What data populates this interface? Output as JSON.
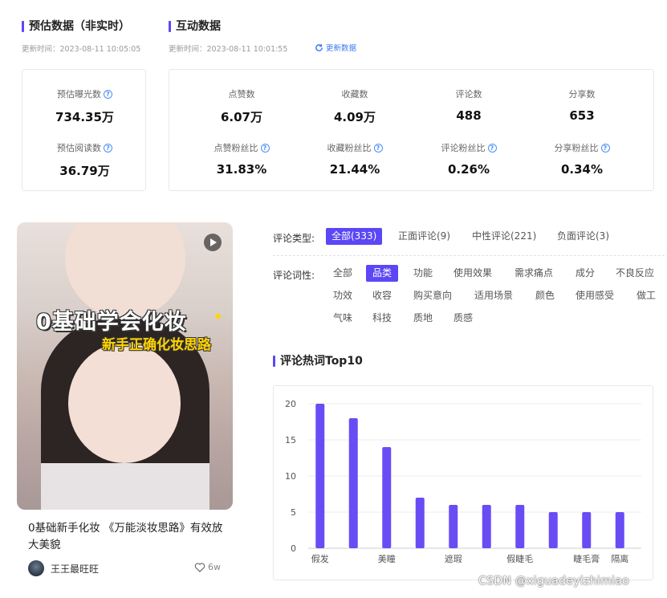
{
  "estimate": {
    "title": "预估数据（非实时）",
    "updated": "更新时间：2023-08-11 10:05:05",
    "metrics": [
      {
        "label": "预估曝光数",
        "value": "734.35万"
      },
      {
        "label": "预估阅读数",
        "value": "36.79万"
      }
    ]
  },
  "interaction": {
    "title": "互动数据",
    "updated": "更新时间：2023-08-11 10:01:55",
    "refresh_label": "更新数据",
    "metrics": [
      {
        "label": "点赞数",
        "value": "6.07万"
      },
      {
        "label": "收藏数",
        "value": "4.09万"
      },
      {
        "label": "评论数",
        "value": "488"
      },
      {
        "label": "分享数",
        "value": "653"
      },
      {
        "label": "点赞粉丝比",
        "value": "31.83%"
      },
      {
        "label": "收藏粉丝比",
        "value": "21.44%"
      },
      {
        "label": "评论粉丝比",
        "value": "0.26%"
      },
      {
        "label": "分享粉丝比",
        "value": "0.34%"
      }
    ]
  },
  "post": {
    "cover_title": "0基础学会化妆",
    "cover_subtitle": "新手正确化妆思路",
    "title": "0基础新手化妆 《万能淡妆思路》有效放大美貌",
    "author": "王王最旺旺",
    "likes": "6w"
  },
  "comment_type": {
    "label": "评论类型:",
    "options": [
      "全部(333)",
      "正面评论(9)",
      "中性评论(221)",
      "负面评论(3)"
    ],
    "selected": "全部(333)"
  },
  "comment_pos": {
    "label": "评论词性:",
    "options": [
      "全部",
      "品类",
      "功能",
      "使用效果",
      "需求痛点",
      "成分",
      "不良反应",
      "功效",
      "收容",
      "购买意向",
      "适用场景",
      "颜色",
      "使用感受",
      "做工",
      "气味",
      "科技",
      "质地",
      "质感"
    ],
    "selected": "品类"
  },
  "chart_title": "评论热词Top10",
  "chart_data": {
    "type": "bar",
    "categories": [
      "假发",
      "",
      "美瞳",
      "",
      "遮瑕",
      "",
      "假睫毛",
      "",
      "睫毛膏",
      "隔离"
    ],
    "values": [
      20,
      18,
      14,
      7,
      6,
      6,
      6,
      5,
      5,
      5
    ],
    "ylim": [
      0,
      20
    ],
    "yticks": [
      0,
      5,
      10,
      15,
      20
    ],
    "color": "#6a4cf5",
    "grid": true
  },
  "watermark": "CSDN @xiguadeyizhimiao"
}
